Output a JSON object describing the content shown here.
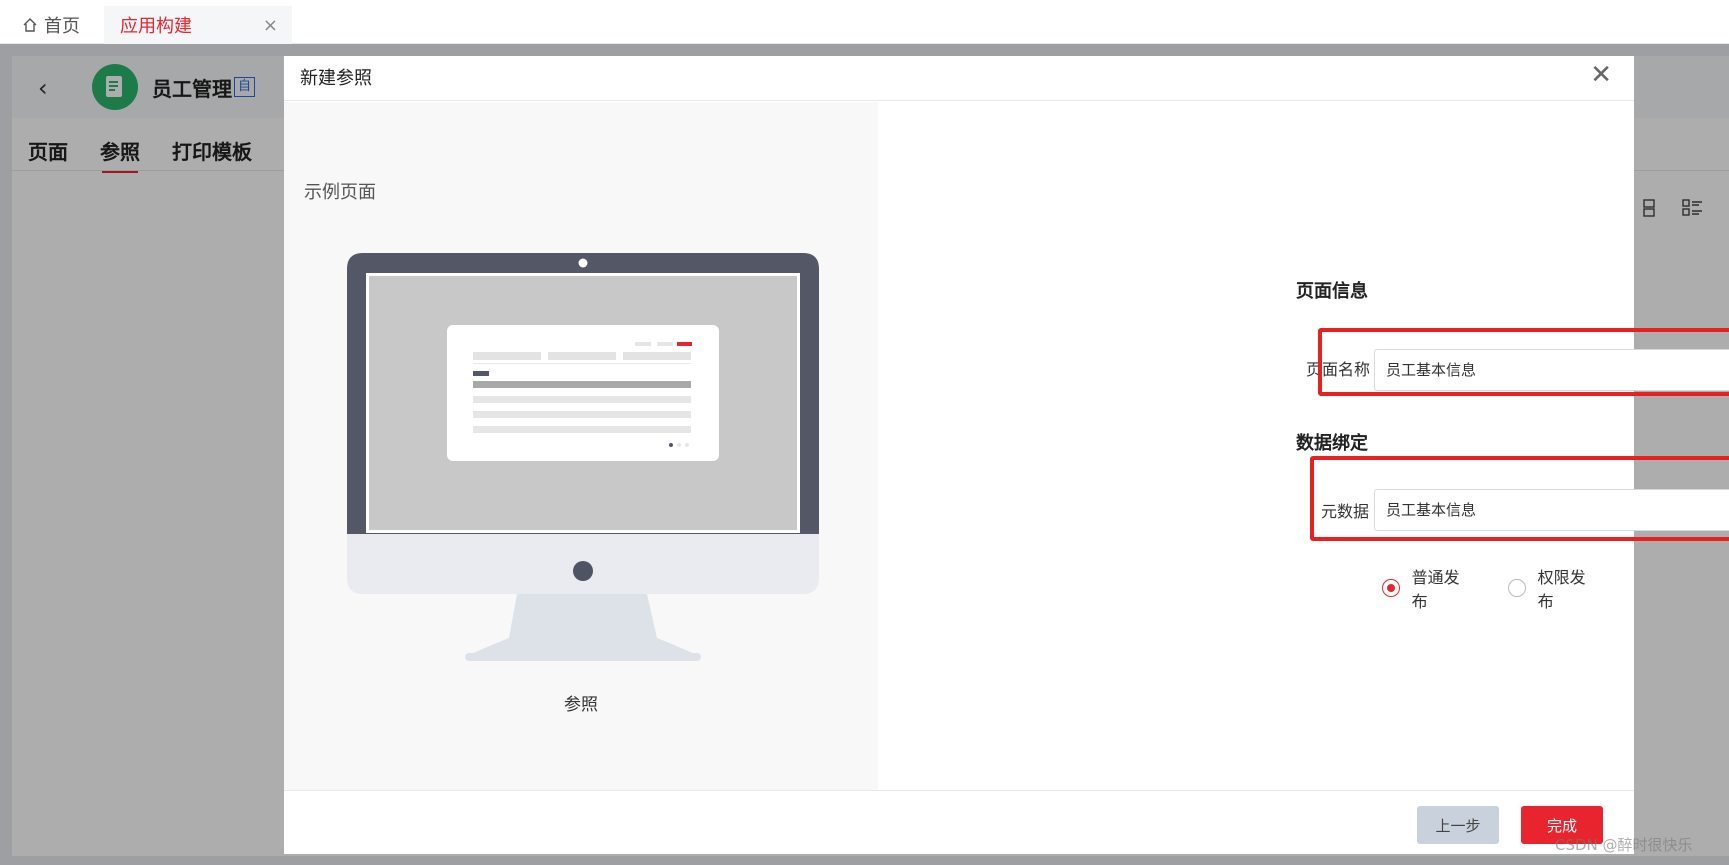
{
  "tabs": {
    "home_label": "首页",
    "app_label": "应用构建",
    "close_glyph": "×"
  },
  "app": {
    "back_glyph": "‹",
    "title": "员工管理",
    "badge": "自",
    "sub_tabs": [
      "页面",
      "参照",
      "打印模板"
    ],
    "active_sub_tab": "参照"
  },
  "modal": {
    "title": "新建参照",
    "close_glyph": "✕",
    "example_label": "示例页面",
    "example_caption": "参照",
    "page_info_title": "页面信息",
    "page_name_label": "页面名称",
    "page_name_value": "员工基本信息",
    "data_binding_title": "数据绑定",
    "metadata_label": "元数据",
    "metadata_value": "员工基本信息",
    "publish_options": [
      {
        "label": "普通发布",
        "checked": true
      },
      {
        "label": "权限发布",
        "checked": false
      }
    ],
    "prev_button": "上一步",
    "finish_button": "完成"
  },
  "watermark": "CSDN @醉时很快乐",
  "colors": {
    "accent": "#e8242e",
    "highlight": "#e82020",
    "app_logo": "#2cb46c"
  },
  "icons": [
    "home-icon",
    "close-icon",
    "back-icon",
    "app-logo-icon",
    "list-icon",
    "monitor-illustration"
  ]
}
